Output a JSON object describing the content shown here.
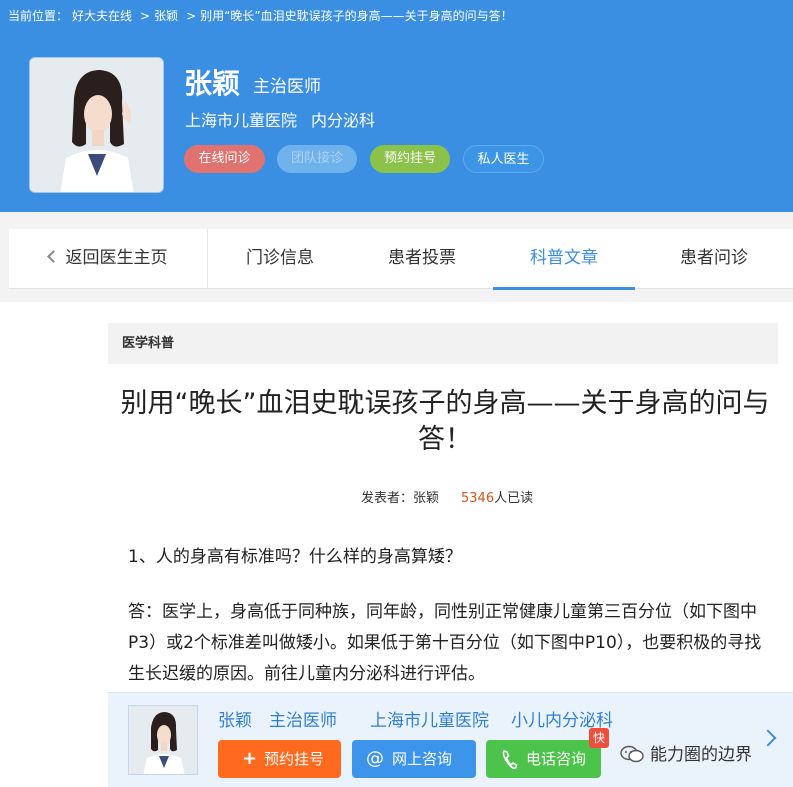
{
  "breadcrumb": {
    "label": "当前位置：",
    "items": [
      "好大夫在线",
      "张颖",
      "别用“晚长”血泪史耽误孩子的身高——关于身高的问与答！"
    ],
    "separator": ">"
  },
  "doctor": {
    "name": "张颖",
    "title": "主治医师",
    "hospital": "上海市儿童医院",
    "department": "内分泌科",
    "actions": [
      "在线问诊",
      "团队接诊",
      "预约挂号",
      "私人医生"
    ]
  },
  "tabs": {
    "back": "返回医生主页",
    "items": [
      "门诊信息",
      "患者投票",
      "科普文章",
      "患者问诊"
    ],
    "active": "科普文章"
  },
  "article": {
    "category": "医学科普",
    "title": "别用“晚长”血泪史耽误孩子的身高——关于身高的问与答！",
    "author_label": "发表者：张颖",
    "reads": "5346",
    "reads_suffix": "人已读",
    "question": "1、人的身高有标准吗？什么样的身高算矮？",
    "answer": "答：医学上，身高低于同种族，同年龄，同性别正常健康儿童第三百分位（如下图中P3）或2个标准差叫做矮小。如果低于第十百分位（如下图中P10），也要积极的寻找生长迟缓的原因。前往儿童内分泌科进行评估。"
  },
  "footer": {
    "name": "张颖",
    "title": "主治医师",
    "hospital": "上海市儿童医院",
    "department": "小儿内分泌科",
    "buttons": {
      "book": "预约挂号",
      "online": "网上咨询",
      "phone": "电话咨询"
    },
    "badge": "快",
    "watermark": "能力圈的边界"
  },
  "icons": [
    "chevron-left-icon",
    "plus-icon",
    "at-icon",
    "phone-icon",
    "chevron-right-icon",
    "wechat-icon"
  ],
  "colors": {
    "header_blue": "#3a8fe2",
    "active_tab": "#3a8fe2",
    "reads_orange": "#d9541e",
    "book_orange": "#ff6a1f",
    "online_blue": "#3c95ea",
    "phone_green": "#4cc34a"
  }
}
